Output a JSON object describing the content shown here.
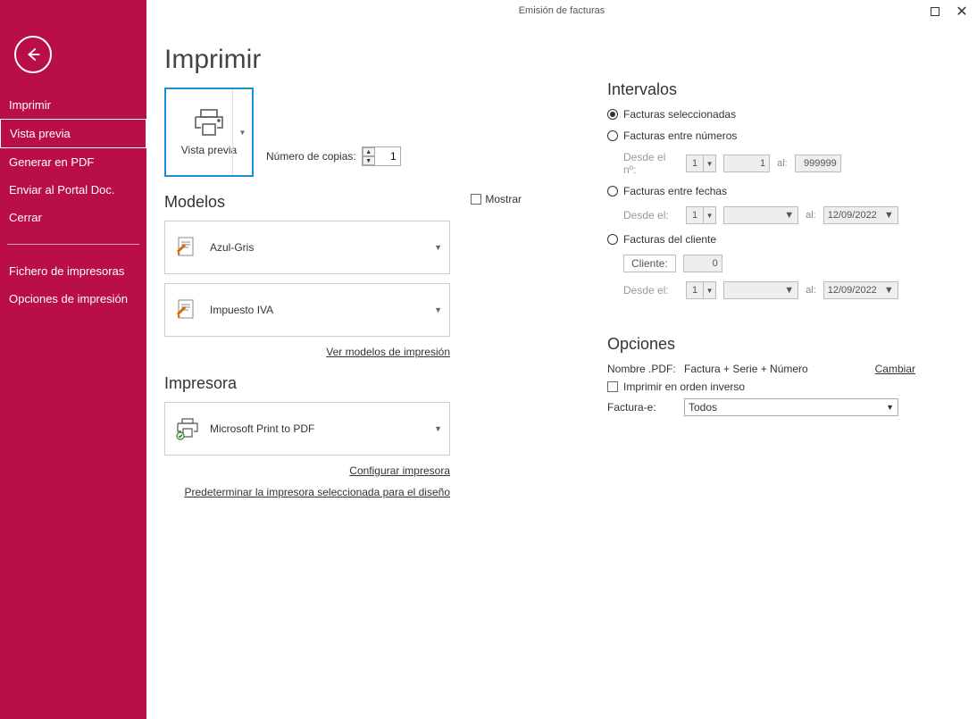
{
  "window": {
    "title": "Emisión de facturas"
  },
  "sidebar": {
    "items": [
      {
        "label": "Imprimir"
      },
      {
        "label": "Vista previa"
      },
      {
        "label": "Generar en PDF"
      },
      {
        "label": "Enviar al Portal Doc."
      },
      {
        "label": "Cerrar"
      }
    ],
    "items2": [
      {
        "label": "Fichero de impresoras"
      },
      {
        "label": "Opciones de impresión"
      }
    ]
  },
  "page_title": "Imprimir",
  "preview": {
    "label": "Vista previa"
  },
  "copies": {
    "label": "Número de copias:",
    "value": "1"
  },
  "modelos": {
    "title": "Modelos",
    "mostrar_label": "Mostrar",
    "items": [
      {
        "label": "Azul-Gris"
      },
      {
        "label": "Impuesto IVA"
      }
    ],
    "ver_link": "Ver modelos de impresión"
  },
  "impresora": {
    "title": "Impresora",
    "selected": "Microsoft Print to PDF",
    "config_link": "Configurar impresora",
    "predet_link": "Predeterminar la impresora seleccionada para el diseño"
  },
  "intervalos": {
    "title": "Intervalos",
    "radios": {
      "seleccionadas": "Facturas seleccionadas",
      "entre_numeros": "Facturas entre números",
      "entre_fechas": "Facturas entre fechas",
      "del_cliente": "Facturas del cliente"
    },
    "desde_n": "Desde el nº:",
    "desde_el": "Desde el:",
    "al": "al:",
    "num_from": "1",
    "num_from_val": "1",
    "num_to": "999999",
    "date_sel": "1",
    "date_to": "12/09/2022",
    "cliente_label": "Cliente:",
    "cliente_val": "0"
  },
  "opciones": {
    "title": "Opciones",
    "nombre_pdf_label": "Nombre .PDF:",
    "nombre_pdf_value": "Factura + Serie + Número",
    "cambiar": "Cambiar",
    "inverso": "Imprimir en orden inverso",
    "factura_e_label": "Factura-e:",
    "factura_e_value": "Todos"
  }
}
